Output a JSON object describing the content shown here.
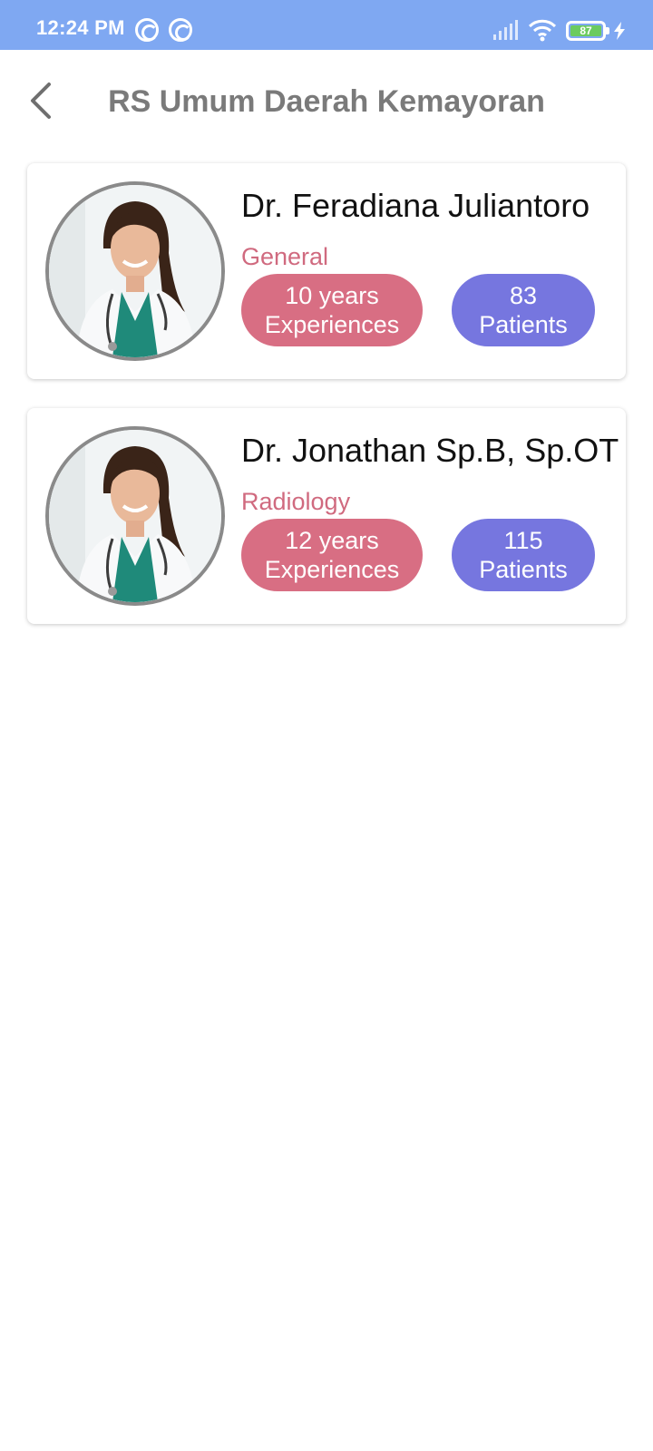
{
  "status_bar": {
    "time": "12:24 PM",
    "battery": "87",
    "icons": [
      "sync-icon",
      "sync-icon",
      "signal-icon",
      "wifi-icon",
      "battery-icon",
      "charging-icon"
    ]
  },
  "header": {
    "title": "RS Umum Daerah Kemayoran",
    "back_icon": "chevron-left-icon"
  },
  "doctors": [
    {
      "name": "Dr. Feradiana Juliantoro",
      "specialty": "General",
      "experience_line1": "10 years",
      "experience_line2": "Experiences",
      "patients_line1": "83",
      "patients_line2": "Patients"
    },
    {
      "name": "Dr. Jonathan Sp.B, Sp.OT",
      "specialty": "Radiology",
      "experience_line1": "12 years",
      "experience_line2": "Experiences",
      "patients_line1": "115",
      "patients_line2": "Patients"
    }
  ],
  "colors": {
    "status_bar": "#7fa8f2",
    "title": "#7a7a7a",
    "specialty": "#d06a7f",
    "experience_pill": "#d86e83",
    "patients_pill": "#7676df"
  }
}
